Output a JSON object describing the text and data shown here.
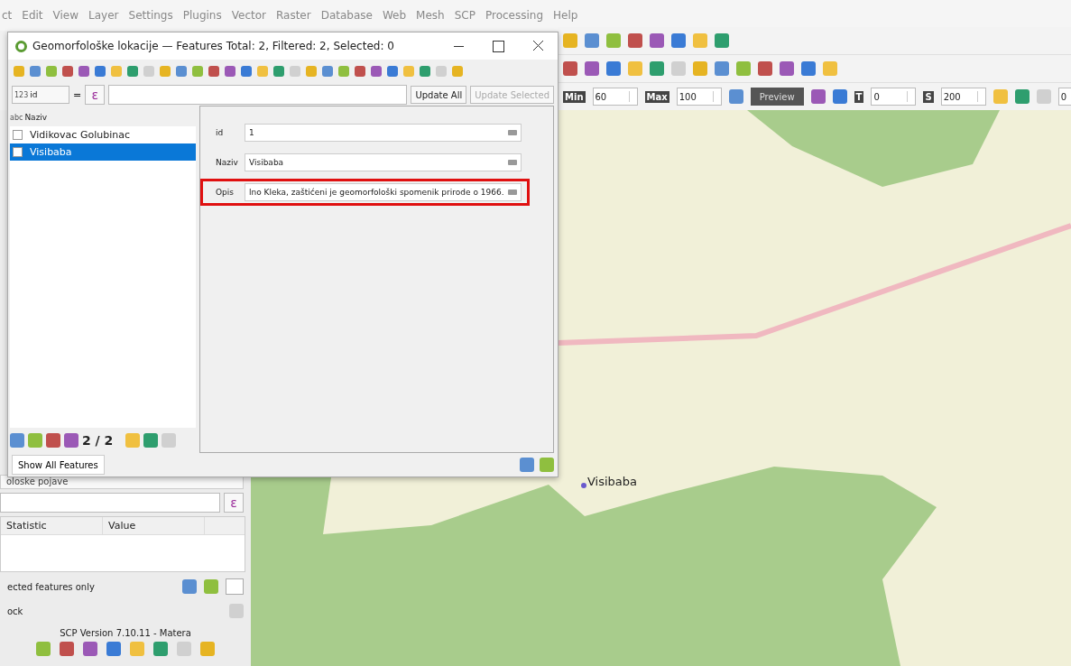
{
  "menu": [
    {
      "label": "ct"
    },
    {
      "label": "Edit"
    },
    {
      "label": "View"
    },
    {
      "label": "Layer"
    },
    {
      "label": "Settings"
    },
    {
      "label": "Plugins"
    },
    {
      "label": "Vector"
    },
    {
      "label": "Raster"
    },
    {
      "label": "Database"
    },
    {
      "label": "Web"
    },
    {
      "label": "Mesh"
    },
    {
      "label": "SCP"
    },
    {
      "label": "Processing"
    },
    {
      "label": "Help"
    }
  ],
  "scp_toolbar": {
    "fields": [
      {
        "tag": "Min",
        "value": "60"
      },
      {
        "tag": "Max",
        "value": "100"
      }
    ],
    "preview": "Preview",
    "fields2": [
      {
        "tag": "T",
        "value": "0"
      },
      {
        "tag": "S",
        "value": "200"
      }
    ],
    "last_value": "0"
  },
  "dialog": {
    "title": "Geomorfološke lokacije — Features Total: 2, Filtered: 2, Selected: 0",
    "field_select": {
      "type_tag": "123",
      "value": "id"
    },
    "equals": "=",
    "epsilon": "ε",
    "update_all": "Update All",
    "update_selected": {
      "label": "Update Selected",
      "disabled": true
    },
    "list_header": {
      "type_tag": "abc",
      "label": "Naziv"
    },
    "items": [
      {
        "label": "Vidikovac Golubinac",
        "selected": false
      },
      {
        "label": "Visibaba",
        "selected": true
      }
    ],
    "form": [
      {
        "label": "id",
        "value": "1",
        "highlighted": false
      },
      {
        "label": "Naziv",
        "value": "Visibaba",
        "highlighted": false
      },
      {
        "label": "Opis",
        "value": "lno Kleka, zaštićeni je geomorfološki spomenik  prirode o 1966.",
        "highlighted": true
      }
    ],
    "counter": "2 / 2",
    "filter_button": "Show All Features"
  },
  "side_panel": {
    "layer_dropdown": "oloske pojave",
    "epsilon": "ε",
    "columns": [
      "Statistic",
      "Value"
    ],
    "selected_only": "ected features only",
    "dock_title": "ock",
    "scp_version": "SCP Version 7.10.11 - Matera"
  },
  "map": {
    "label": "Visibaba"
  }
}
